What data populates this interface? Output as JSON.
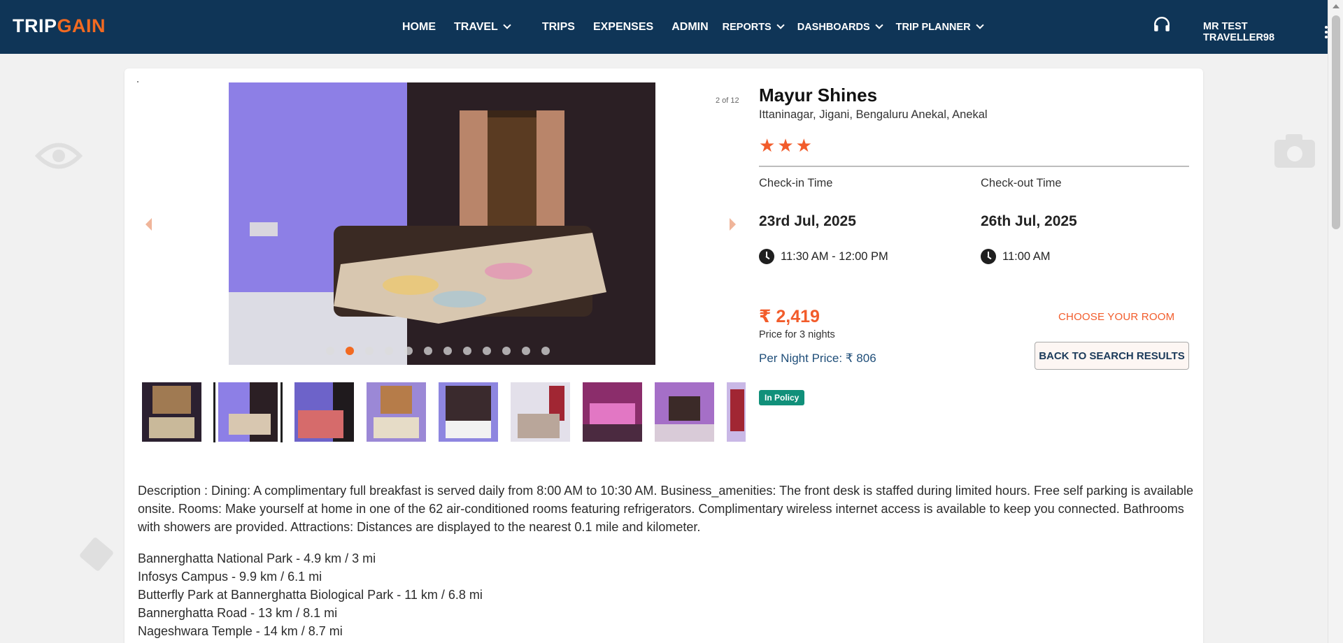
{
  "header": {
    "logo_part1": "TRIP",
    "logo_part2": "GAIN",
    "nav": [
      {
        "label": "HOME"
      },
      {
        "label": "TRAVEL"
      },
      {
        "label": "TRIPS"
      },
      {
        "label": "EXPENSES"
      },
      {
        "label": "ADMIN"
      },
      {
        "label": "REPORTS"
      },
      {
        "label": "DASHBOARDS"
      },
      {
        "label": "TRIP PLANNER"
      }
    ],
    "support_icon": "headset-icon",
    "user_name": "MR TEST TRAVELLER98"
  },
  "gallery": {
    "counter": "2 of 12",
    "dot_count": 12,
    "active_index": 1,
    "thumb_count": 9
  },
  "hotel": {
    "name": "Mayur Shines",
    "address": "Ittaninagar, Jigani, Bengaluru Anekal, Anekal",
    "star_rating": 3,
    "checkin_label": "Check-in Time",
    "checkout_label": "Check-out Time",
    "checkin_date": "23rd Jul, 2025",
    "checkout_date": "26th Jul, 2025",
    "checkin_time": "11:30 AM - 12:00 PM",
    "checkout_time": "11:00 AM",
    "price": "₹ 2,419",
    "price_note": "Price for 3 nights",
    "per_night": "Per Night Price: ₹ 806",
    "choose_room": "CHOOSE YOUR ROOM",
    "back_button": "BACK TO SEARCH RESULTS",
    "policy_badge": "In Policy"
  },
  "description": "Description : Dining: A complimentary full breakfast is served daily from 8:00 AM to 10:30 AM. Business_amenities: The front desk is staffed during limited hours. Free self parking is available onsite. Rooms: Make yourself at home in one of the 62 air-conditioned rooms featuring refrigerators. Complimentary wireless internet access is available to keep you connected. Bathrooms with showers are provided. Attractions: Distances are displayed to the nearest 0.1 mile and kilometer.",
  "attractions": [
    "Bannerghatta National Park - 4.9 km / 3 mi",
    "Infosys Campus - 9.9 km / 6.1 mi",
    "Butterfly Park at Bannerghatta Biological Park - 11 km / 6.8 mi",
    "Bannerghatta Road - 13 km / 8.1 mi",
    "Nageshwara Temple - 14 km / 8.7 mi"
  ],
  "colors": {
    "header_bg": "#0f3557",
    "accent": "#f26a21",
    "policy": "#11907a"
  }
}
